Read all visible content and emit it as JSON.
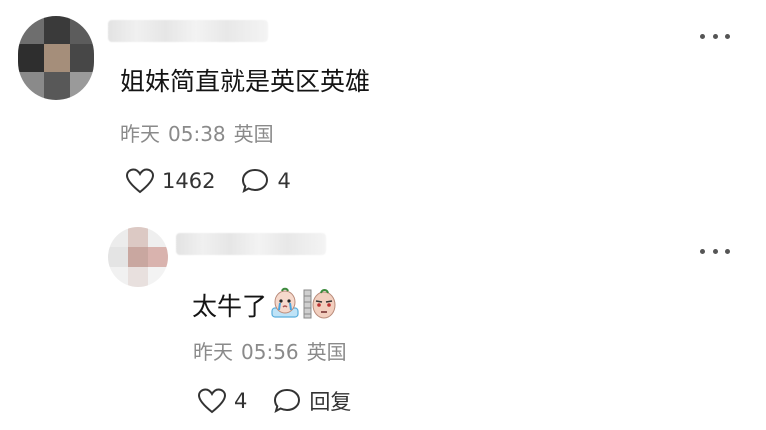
{
  "comments": [
    {
      "text": "姐妹简直就是英区英雄",
      "meta": {
        "date": "昨天",
        "time": "05:38",
        "location": "英国"
      },
      "likes": "1462",
      "replies": "4"
    },
    {
      "text": "太牛了",
      "emojis": [
        "crying-emoji",
        "shocked-emoji"
      ],
      "meta": {
        "date": "昨天",
        "time": "05:56",
        "location": "英国"
      },
      "likes": "4",
      "reply_label": "回复"
    }
  ],
  "icons": {
    "like": "heart-outline-icon",
    "comment": "speech-bubble-icon",
    "more": "more-horizontal-icon"
  }
}
